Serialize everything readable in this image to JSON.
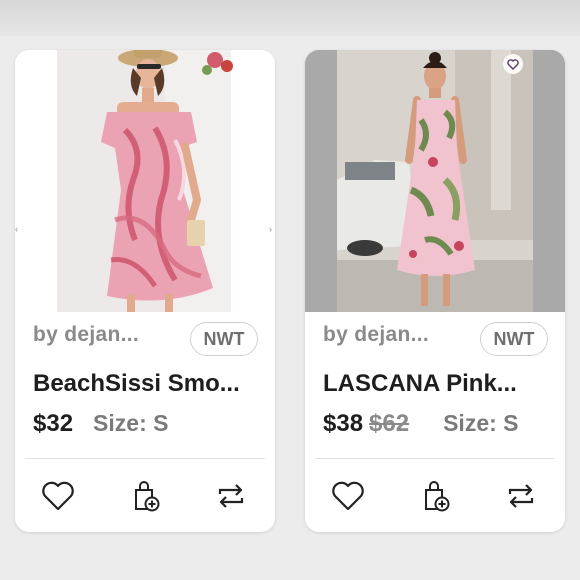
{
  "listings": [
    {
      "seller": "by dejan...",
      "condition_badge": "NWT",
      "title": "BeachSissi Smo...",
      "price": "$32",
      "original_price": "",
      "size": "Size: S",
      "image": "pink floral off-shoulder smocked dress photo",
      "colors": {
        "dress": "#e88ea2",
        "accent": "#c6445e"
      }
    },
    {
      "seller": "by dejan...",
      "condition_badge": "NWT",
      "title": "LASCANA Pink...",
      "price": "$38",
      "original_price": "$62",
      "size": "Size: S",
      "image": "pink tropical print sundress street photo",
      "colors": {
        "dress": "#f1c3cf",
        "accent": "#6e8a4f"
      }
    }
  ],
  "actions": {
    "like_icon": "heart-icon",
    "bundle_icon": "bag-plus-icon",
    "share_icon": "share-icon"
  },
  "theme": {
    "page_bg": "#ececec",
    "card_bg": "#ffffff",
    "text_dark": "#1e1e1e",
    "text_muted": "#8a8a8a"
  }
}
